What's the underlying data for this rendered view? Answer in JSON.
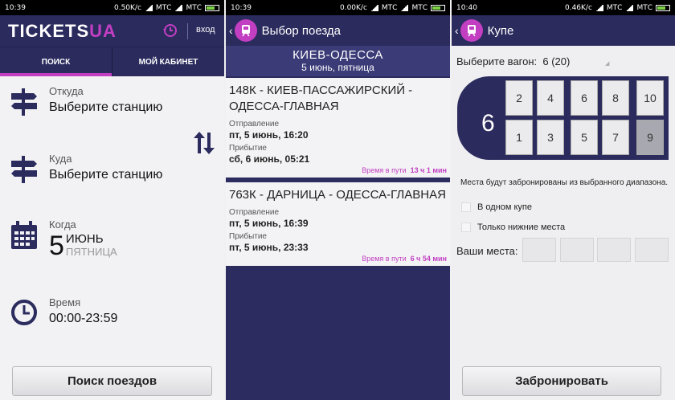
{
  "screen1": {
    "status": {
      "time": "10:39",
      "speed": "0.50K/c",
      "carrier1": "МТС",
      "carrier2": "МТС"
    },
    "brand": {
      "part1": "TICKETS",
      "part2": "UA"
    },
    "login": "вход",
    "tabs": [
      "ПОИСК",
      "МОЙ КАБИНЕТ"
    ],
    "from": {
      "label": "Откуда",
      "value": "Выберите станцию"
    },
    "to": {
      "label": "Куда",
      "value": "Выберите станцию"
    },
    "when": {
      "label": "Когда",
      "day": "5",
      "month": "июнь",
      "weekday": "пятница"
    },
    "time": {
      "label": "Время",
      "value": "00:00-23:59"
    },
    "search_button": "Поиск поездов"
  },
  "screen2": {
    "status": {
      "time": "10:39",
      "speed": "0.00K/c",
      "carrier1": "МТС",
      "carrier2": "МТС"
    },
    "title": "Выбор поезда",
    "route": "КИЕВ-ОДЕССА",
    "date": "5 июнь, пятница",
    "trains": [
      {
        "name": "148К - КИЕВ-ПАССАЖИРСКИЙ - ОДЕССА-ГЛАВНАЯ",
        "dep_label": "Отправление",
        "dep": "пт, 5 июнь, 16:20",
        "arr_label": "Прибытие",
        "arr": "сб, 6 июнь, 05:21",
        "dur_label": "Время в пути",
        "dur": "13 ч 1 мин"
      },
      {
        "name": "763К - ДАРНИЦА - ОДЕССА-ГЛАВНАЯ",
        "dep_label": "Отправление",
        "dep": "пт, 5 июнь, 16:39",
        "arr_label": "Прибытие",
        "arr": "пт, 5 июнь, 23:33",
        "dur_label": "Время в пути",
        "dur": "6 ч 54 мин"
      }
    ]
  },
  "screen3": {
    "status": {
      "time": "10:40",
      "speed": "0.46K/c",
      "carrier1": "МТС",
      "carrier2": "МТС"
    },
    "title": "Купе",
    "select_label": "Выберите вагон:",
    "select_value": "6 (20)",
    "coach_number": "6",
    "seats_top": [
      "2",
      "4",
      "6",
      "8",
      "10"
    ],
    "seats_bottom": [
      "1",
      "3",
      "5",
      "7",
      "9"
    ],
    "note": "Места будут забронированы из выбранного диапазона.",
    "check1": "В одном купе",
    "check2": "Только нижние места",
    "places_label": "Ваши места:",
    "book_button": "Забронировать"
  }
}
